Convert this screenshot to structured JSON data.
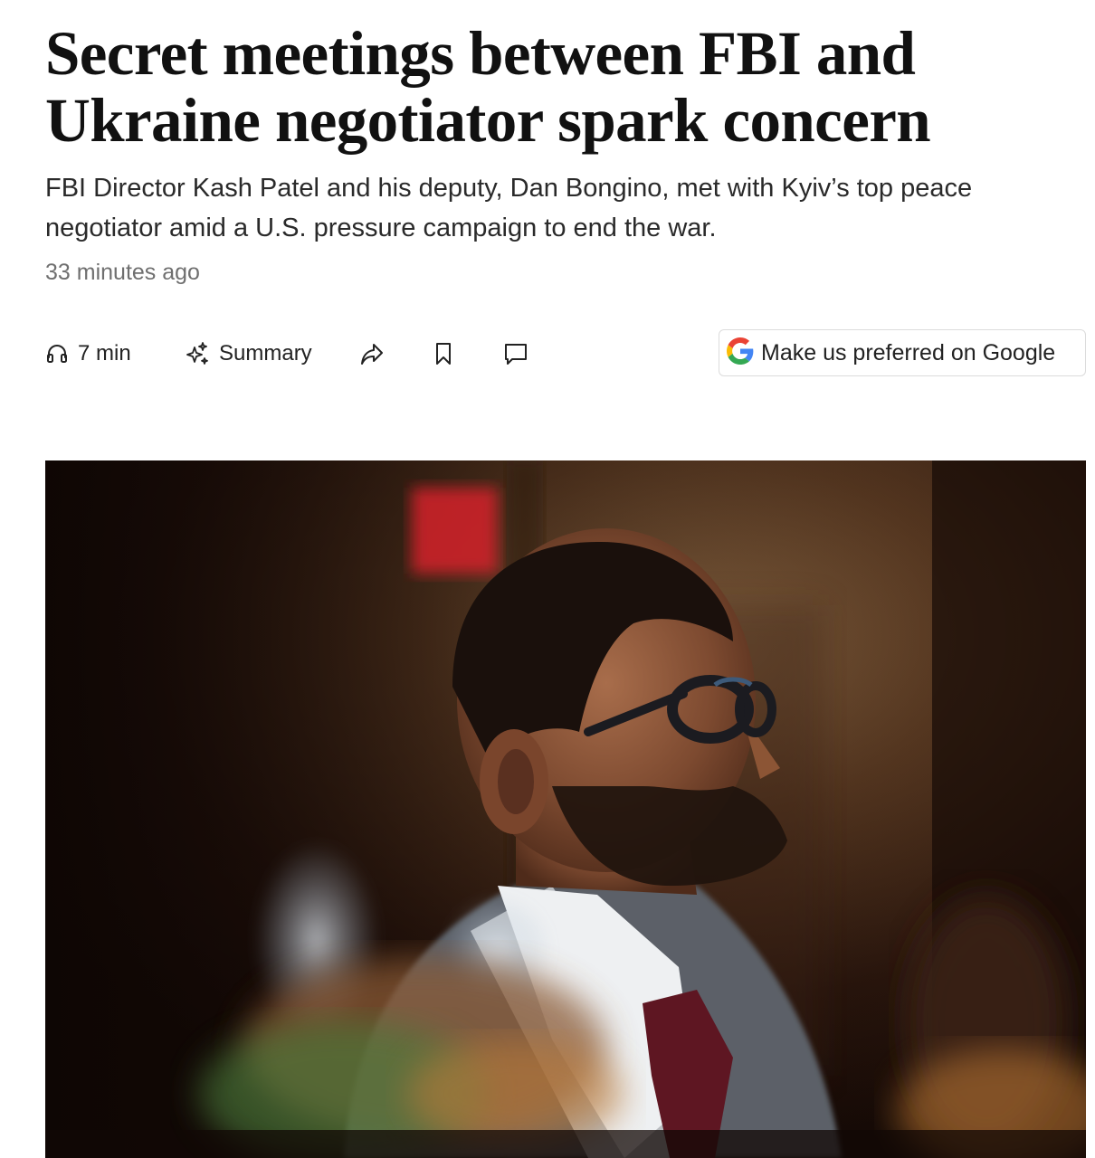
{
  "article": {
    "headline": "Secret meetings between FBI and Ukraine negotiator spark concern",
    "subheadline": "FBI Director Kash Patel and his deputy, Dan Bongino, met with Kyiv’s top peace negotiator amid a U.S. pressure campaign to end the war.",
    "timestamp": "33 minutes ago"
  },
  "toolbar": {
    "listen": {
      "icon": "headphones-icon",
      "label": "7 min"
    },
    "summary": {
      "icon": "sparkle-icon",
      "label": "Summary"
    },
    "share": {
      "icon": "share-arrow-icon"
    },
    "save": {
      "icon": "bookmark-icon"
    },
    "comments": {
      "icon": "comment-icon"
    },
    "google_preferred": {
      "icon": "google-g-icon",
      "label": "Make us preferred on Google"
    }
  },
  "colors": {
    "headline": "#111111",
    "subheadline": "#2a2a2a",
    "timestamp": "#6f6f6f",
    "google_blue": "#4285F4",
    "google_red": "#EA4335",
    "google_yellow": "#FBBC05",
    "google_green": "#34A853"
  }
}
